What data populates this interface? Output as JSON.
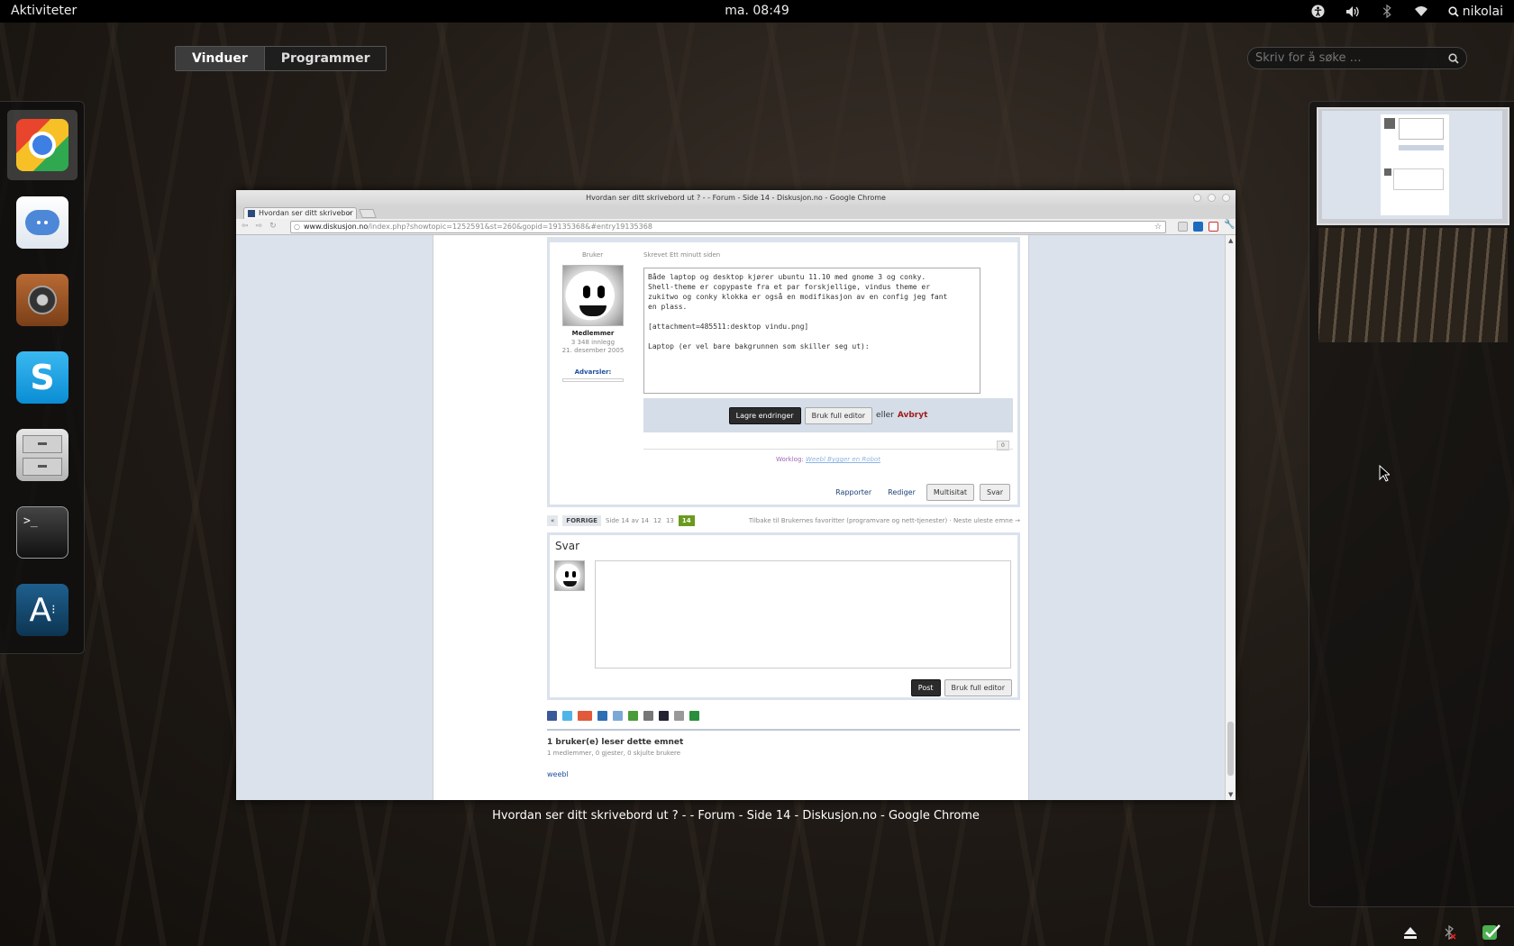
{
  "topbar": {
    "activities": "Aktiviteter",
    "clock": "ma. 08:49",
    "user": "nikolai",
    "icons": [
      "accessibility-icon",
      "volume-icon",
      "bluetooth-icon",
      "wifi-icon"
    ]
  },
  "overview": {
    "tabs": [
      {
        "label": "Vinduer",
        "active": true
      },
      {
        "label": "Programmer",
        "active": false
      }
    ],
    "search_placeholder": "Skriv for å søke …"
  },
  "dash": {
    "apps": [
      {
        "name": "Google Chrome",
        "icon": "chrome-icon",
        "running": true
      },
      {
        "name": "Empathy",
        "icon": "chat-icon",
        "running": false
      },
      {
        "name": "Rhythmbox",
        "icon": "speaker-icon",
        "running": false
      },
      {
        "name": "Skype",
        "icon": "skype-icon",
        "running": false
      },
      {
        "name": "Files",
        "icon": "file-cabinet-icon",
        "running": false
      },
      {
        "name": "Terminal",
        "icon": "terminal-icon",
        "running": false
      },
      {
        "name": "Applications",
        "icon": "applications-icon",
        "running": false
      }
    ]
  },
  "window": {
    "titlebar": "Hvordan ser ditt skrivebord ut ? - - Forum - Side 14 - Diskusjon.no - Google Chrome",
    "tab_label": "Hvordan ser ditt skrivebor",
    "url_domain": "www.diskusjon.no",
    "url_path": "/index.php?showtopic=1252591&st=260&gopid=19135368&#entry19135368",
    "post": {
      "author_label": "Bruker",
      "time": "Skrevet Ett minutt siden",
      "group": "Medlemmer",
      "post_count": "3 348 innlegg",
      "joined": "21. desember 2005",
      "warnings_label": "Advarsler:",
      "editor_text": "Både laptop og desktop kjører ubuntu 11.10 med gnome 3 og conky.\nShell-theme er copypaste fra et par forskjellige, vindus theme er\nzukitwo og conky klokka er også en modifikasjon av en config jeg fant\nen plass.\n\n[attachment=485511:desktop vindu.png]\n\nLaptop (er vel bare bakgrunnen som skiller seg ut):",
      "save_label": "Lagre endringer",
      "full_editor_label": "Bruk full editor",
      "or_label": "eller",
      "cancel_label": "Avbryt",
      "counter": "0",
      "worklog_label": "Worklog:",
      "worklog_link": "Weebl Bygger en Robot",
      "actions": [
        "Rapporter",
        "Rediger",
        "Multisitat",
        "Svar"
      ]
    },
    "pager": {
      "prev_symbol": "«",
      "prev_label": "FORRIGE",
      "page_info": "Side 14 av 14",
      "pages": [
        "12",
        "13",
        "14"
      ],
      "current_page": "14",
      "back_link": "Tilbake til Brukernes favoritter (programvare og nett-tjenester) · Neste uleste emne →"
    },
    "reply": {
      "title": "Svar",
      "post_label": "Post",
      "full_editor_label": "Bruk full editor"
    },
    "readers": {
      "title": "1 bruker(e) leser dette emnet",
      "subtitle": "1 medlemmer, 0 gjester, 0 skjulte brukere",
      "user": "weebl"
    }
  },
  "caption": "Hvordan ser ditt skrivebord ut ? - - Forum - Side 14 - Diskusjon.no - Google Chrome"
}
